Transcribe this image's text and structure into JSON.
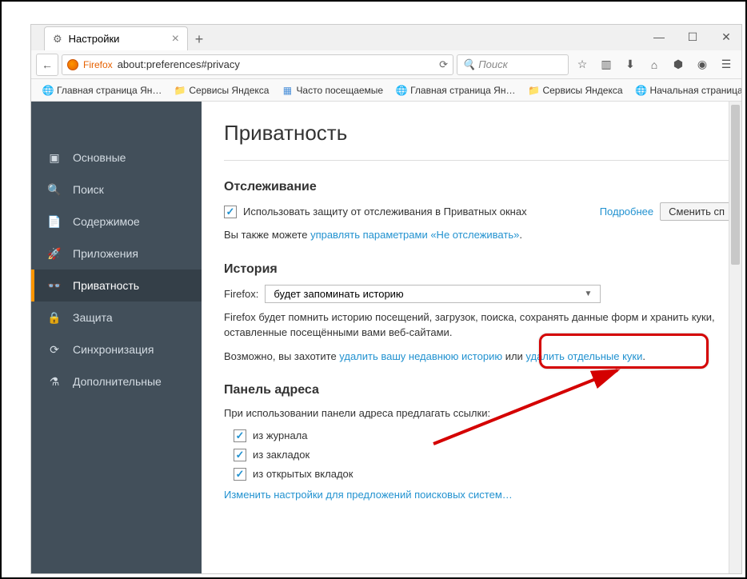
{
  "tab": {
    "title": "Настройки"
  },
  "url": {
    "prefix": "Firefox",
    "path": "about:preferences#privacy"
  },
  "search": {
    "placeholder": "Поиск"
  },
  "bookmarks": [
    {
      "label": "Главная страница Ян…",
      "icon": "globe"
    },
    {
      "label": "Сервисы Яндекса",
      "icon": "folder"
    },
    {
      "label": "Часто посещаемые",
      "icon": "blue"
    },
    {
      "label": "Главная страница Ян…",
      "icon": "globe"
    },
    {
      "label": "Сервисы Яндекса",
      "icon": "folder"
    },
    {
      "label": "Начальная страница",
      "icon": "globe"
    }
  ],
  "sidebar": {
    "items": [
      {
        "label": "Основные",
        "icon": "▣"
      },
      {
        "label": "Поиск",
        "icon": "🔍"
      },
      {
        "label": "Содержимое",
        "icon": "📄"
      },
      {
        "label": "Приложения",
        "icon": "🚀"
      },
      {
        "label": "Приватность",
        "icon": "👓",
        "active": true
      },
      {
        "label": "Защита",
        "icon": "🔒"
      },
      {
        "label": "Синхронизация",
        "icon": "⟳"
      },
      {
        "label": "Дополнительные",
        "icon": "⚗"
      }
    ]
  },
  "page": {
    "title": "Приватность",
    "tracking": {
      "heading": "Отслеживание",
      "checkbox_label": "Использовать защиту от отслеживания в Приватных окнах",
      "learn_more": "Подробнее",
      "change_btn": "Сменить сп",
      "subtext_prefix": "Вы также можете ",
      "subtext_link": "управлять параметрами «Не отслеживать»",
      "subtext_suffix": "."
    },
    "history": {
      "heading": "История",
      "label": "Firefox:",
      "select": "будет запоминать историю",
      "desc": "Firefox будет помнить историю посещений, загрузок, поиска, сохранять данные форм и хранить куки, оставленные посещёнными вами веб-сайтами.",
      "option_prefix": "Возможно, вы захотите ",
      "option_link1": "удалить вашу недавнюю историю",
      "option_mid": " или ",
      "option_link2": "удалить отдельные куки",
      "option_suffix": "."
    },
    "locationbar": {
      "heading": "Панель адреса",
      "desc": "При использовании панели адреса предлагать ссылки:",
      "items": [
        "из журнала",
        "из закладок",
        "из открытых вкладок"
      ],
      "change_link": "Изменить настройки для предложений поисковых систем…"
    }
  }
}
